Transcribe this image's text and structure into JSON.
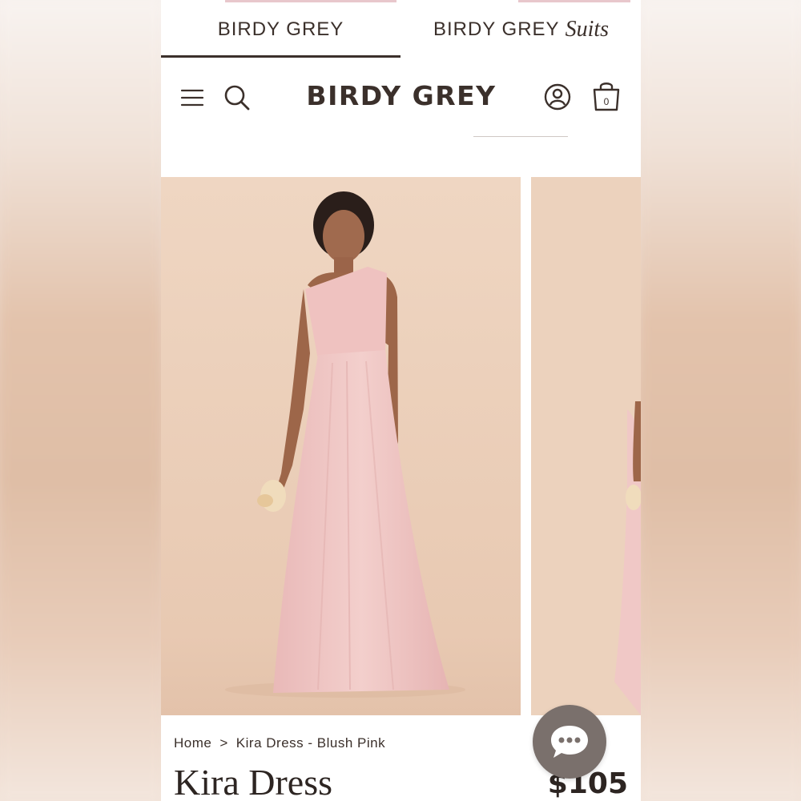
{
  "brand_tabs": [
    {
      "label": "BIRDY GREY",
      "suffix": ""
    },
    {
      "label": "BIRDY GREY",
      "suffix": "Suits"
    }
  ],
  "header": {
    "logo": "BIRDY GREY",
    "cart_count": "0",
    "icons": [
      "menu-icon",
      "search-icon",
      "account-icon",
      "shopping-bag-icon"
    ]
  },
  "breadcrumb": {
    "home": "Home",
    "separator": ">",
    "current": "Kira Dress - Blush Pink"
  },
  "product": {
    "title": "Kira Dress",
    "price": "$105"
  },
  "colors": {
    "text": "#3b302b",
    "dress": "#f0c8c6",
    "backdrop": "#ecd2bd",
    "chat_button": "#7a706c"
  }
}
